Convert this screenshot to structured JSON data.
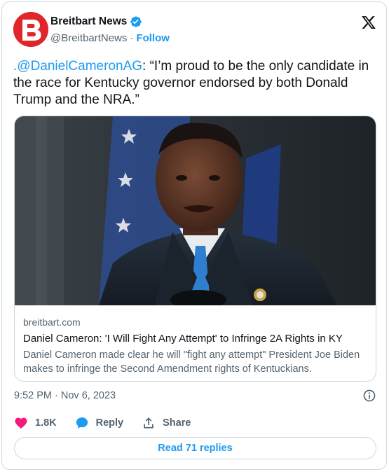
{
  "account": {
    "name": "Breitbart News",
    "handle": "@BreitbartNews",
    "separator": "·",
    "follow_label": "Follow",
    "avatar_icon": "breitbart-b-logo",
    "brand_color": "#e0262b",
    "verified_color": "#1d9bf0"
  },
  "tweet": {
    "mention": ".@DanielCameronAG",
    "text": ": “I’m proud to be the only candidate in the race for Kentucky governor endorsed by both Donald Trump and the NRA.”"
  },
  "link_card": {
    "image_description_icon": "photo-man-at-podium",
    "domain": "breitbart.com",
    "title": "Daniel Cameron: 'I Will Fight Any Attempt' to Infringe 2A Rights in KY",
    "description": "Daniel Cameron made clear he will \"fight any attempt\" President Joe Biden makes to infringe the Second Amendment rights of Kentuckians."
  },
  "meta": {
    "timestamp": "9:52 PM · Nov 6, 2023"
  },
  "actions": {
    "like_count": "1.8K",
    "reply_label": "Reply",
    "share_label": "Share",
    "like_color": "#f91880",
    "reply_color": "#1d9bf0"
  },
  "read_replies": {
    "label": "Read 71 replies"
  }
}
